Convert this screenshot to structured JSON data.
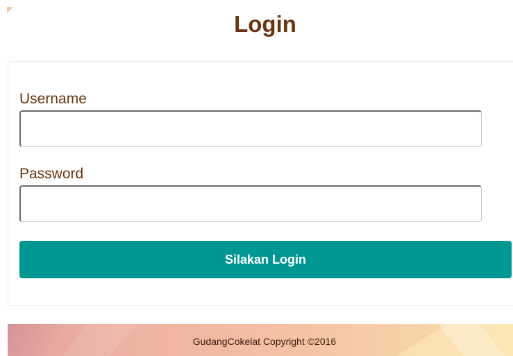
{
  "header": {
    "title": "Login"
  },
  "form": {
    "username_label": "Username",
    "username_value": "",
    "password_label": "Password",
    "password_value": "",
    "submit_label": "Silakan Login"
  },
  "footer": {
    "copyright": "GudangCokelat Copyright ©2016"
  },
  "colors": {
    "title_text": "#6b3410",
    "button_background": "#009793",
    "button_text": "#ffffff"
  }
}
